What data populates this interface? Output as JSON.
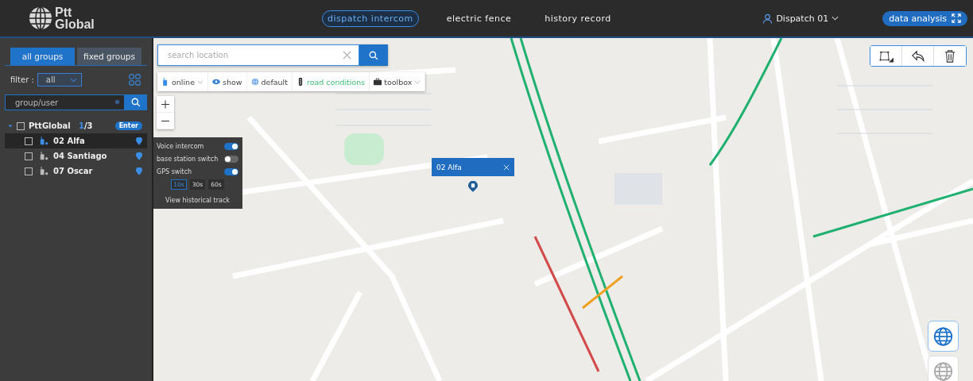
{
  "header": {
    "logo_top": "Ptt",
    "logo_bottom": "Global",
    "nav": [
      {
        "label": "dispatch intercom",
        "selected": true
      },
      {
        "label": "electric fence",
        "selected": false
      },
      {
        "label": "history record",
        "selected": false
      }
    ],
    "user": "Dispatch 01",
    "data_button": "data analysis"
  },
  "sidebar": {
    "tabs": [
      {
        "label": "all groups",
        "selected": true
      },
      {
        "label": "fixed groups",
        "selected": false
      }
    ],
    "filter_label": "filter :",
    "filter_value": "all",
    "search": {
      "placeholder": "group/user"
    },
    "tree": [
      {
        "name": "PttGlobal",
        "count_online": "1",
        "count_total": "/3",
        "expanded": true,
        "checked": false,
        "button": "Enter",
        "children": [
          {
            "name": "02 Alfa",
            "checked": false,
            "online": true,
            "selected": true
          },
          {
            "name": "04 Santiago",
            "checked": false,
            "online": false,
            "selected": false
          },
          {
            "name": "07 Oscar",
            "checked": false,
            "online": false,
            "selected": false
          }
        ]
      }
    ]
  },
  "user_popup": {
    "switches": [
      {
        "label": "Voice intercom",
        "on": true
      },
      {
        "label": "base station switch",
        "on": false
      },
      {
        "label": "GPS switch",
        "on": true
      }
    ],
    "intervals": [
      {
        "label": "10s",
        "selected": true
      },
      {
        "label": "30s",
        "selected": false
      },
      {
        "label": "60s",
        "selected": false
      }
    ],
    "link": "View historical track"
  },
  "map": {
    "search": {
      "placeholder": "search location"
    },
    "toolbar": [
      {
        "kind": "radio",
        "label": "online",
        "active": false,
        "dropdown": true
      },
      {
        "kind": "eye",
        "label": "show",
        "active": false,
        "dropdown": false
      },
      {
        "kind": "globe",
        "label": "default",
        "active": false,
        "dropdown": false
      },
      {
        "kind": "traffic",
        "label": "road conditions",
        "active": true,
        "dropdown": false
      },
      {
        "kind": "toolbox",
        "label": "toolbox",
        "active": false,
        "dropdown": true
      }
    ],
    "marker_popup": {
      "title": "02 Alfa"
    },
    "layer_buttons": [
      {
        "selected": true
      },
      {
        "selected": false
      }
    ]
  }
}
